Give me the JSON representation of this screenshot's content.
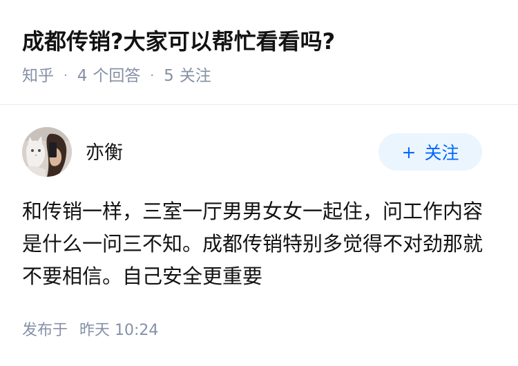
{
  "question": {
    "title": "成都传销?大家可以帮忙看看吗?",
    "source": "知乎",
    "answers_count": "4",
    "answers_label": "个回答",
    "followers_count": "5",
    "followers_label": "关注"
  },
  "answer": {
    "author": {
      "name": "亦衡",
      "avatar": "avatar-photo"
    },
    "follow_button": {
      "icon": "plus-icon",
      "plus": "+",
      "label": "关注"
    },
    "content": "和传销一样，三室一厅男男女女一起住，问工作内容是什么一问三不知。成都传销特别多觉得不对劲那就不要相信。自己安全更重要",
    "published_label": "发布于",
    "published_time": "昨天 10:24"
  },
  "colors": {
    "meta_text": "#8590a6",
    "accent": "#0066ff",
    "follow_bg": "#ebf5fd",
    "divider": "#ebebeb"
  }
}
